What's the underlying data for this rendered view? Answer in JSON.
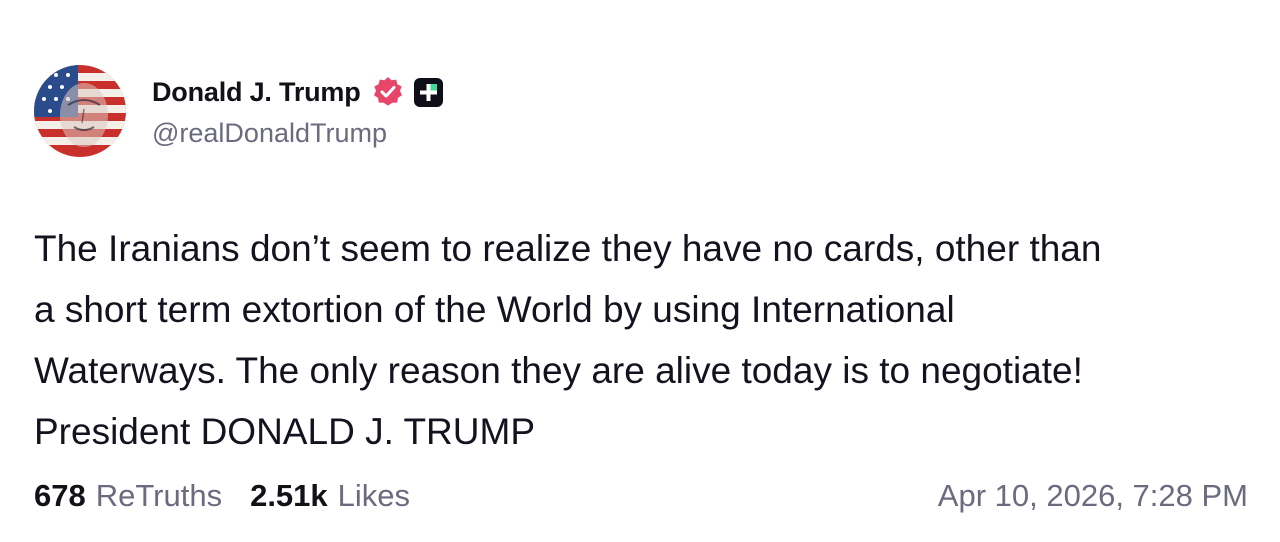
{
  "post": {
    "author": {
      "display_name": "Donald J. Trump",
      "handle": "@realDonaldTrump",
      "verified_color": "#e8456b",
      "badge_color": "#0f0f1a"
    },
    "body": [
      "The Iranians don’t seem to realize they have no cards, other than",
      "a short term extortion of the World by using International",
      "Waterways. The only reason they are alive today is to negotiate!",
      "President DONALD J. TRUMP"
    ],
    "stats": {
      "retruths_count": "678",
      "retruths_label": "ReTruths",
      "likes_count": "2.51k",
      "likes_label": "Likes"
    },
    "timestamp": "Apr 10, 2026, 7:28 PM"
  }
}
